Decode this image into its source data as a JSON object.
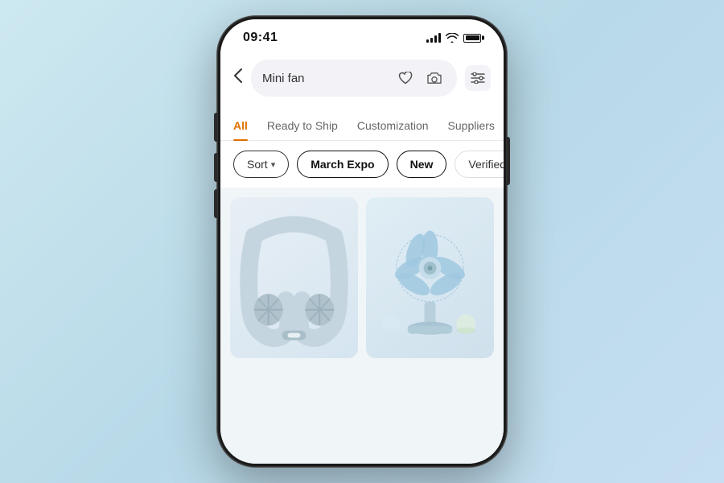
{
  "phone": {
    "status_bar": {
      "time": "09:41",
      "signal_label": "signal",
      "wifi_label": "wifi",
      "battery_label": "battery"
    },
    "search": {
      "back_label": "‹",
      "query": "Mini fan",
      "heart_icon": "♡",
      "camera_icon": "⊙",
      "filter_icon": "≡"
    },
    "tabs": [
      {
        "id": "all",
        "label": "All",
        "active": true
      },
      {
        "id": "ready",
        "label": "Ready to Ship",
        "active": false
      },
      {
        "id": "custom",
        "label": "Customization",
        "active": false
      },
      {
        "id": "suppliers",
        "label": "Suppliers",
        "active": false
      }
    ],
    "filters": [
      {
        "id": "sort",
        "label": "Sort",
        "type": "sort",
        "has_chevron": true
      },
      {
        "id": "march-expo",
        "label": "March Expo",
        "type": "active"
      },
      {
        "id": "new",
        "label": "New",
        "type": "active"
      },
      {
        "id": "verified",
        "label": "Verified suppliers",
        "type": "default"
      }
    ],
    "products": [
      {
        "id": "neck-fan",
        "type": "neck_fan"
      },
      {
        "id": "desk-fan",
        "type": "desk_fan"
      }
    ]
  },
  "colors": {
    "accent": "#e07000",
    "active_tab": "#e07000",
    "chip_active_border": "#111111",
    "chip_sort_border": "#333333"
  }
}
